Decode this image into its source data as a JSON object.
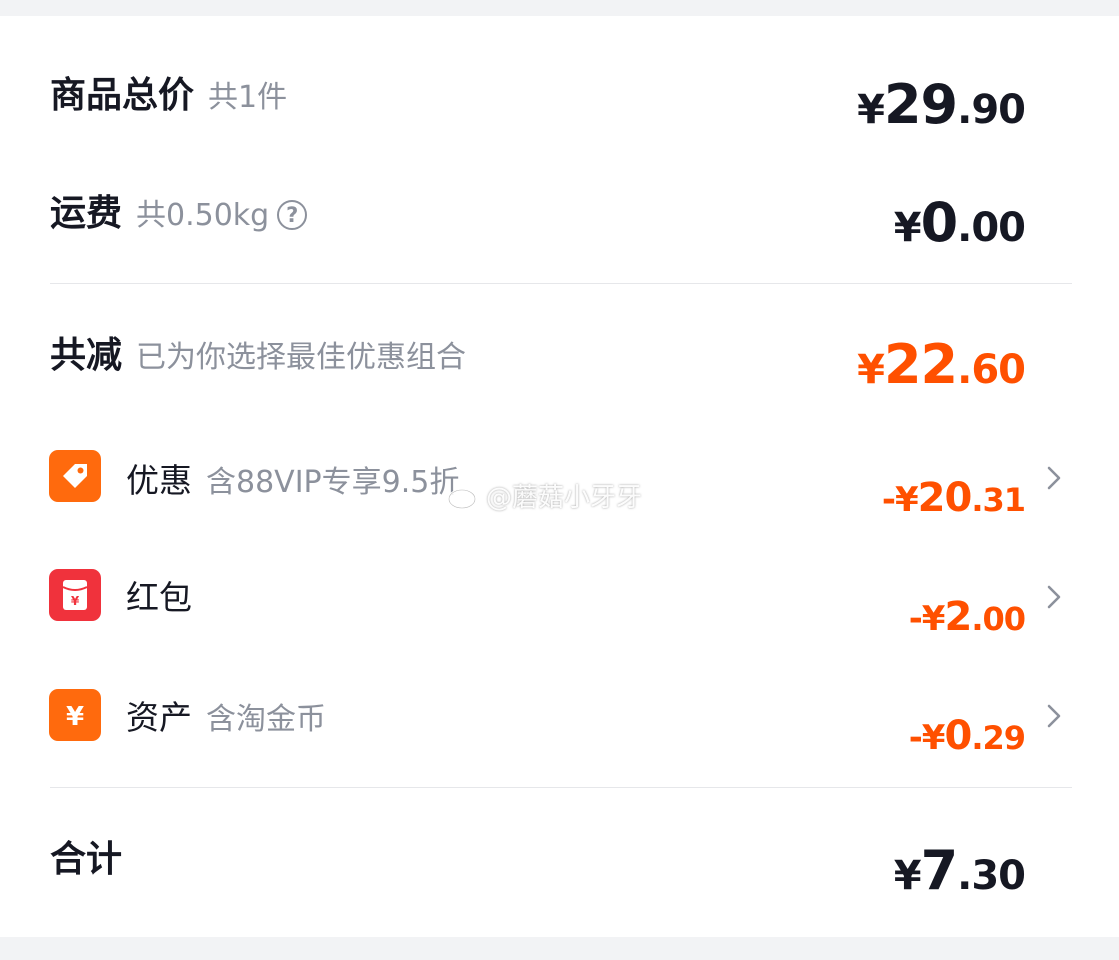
{
  "summary": {
    "goods_total": {
      "label": "商品总价",
      "note": "共1件",
      "currency": "¥",
      "int": "29",
      "dec": ".90"
    },
    "shipping": {
      "label": "运费",
      "note": "共0.50kg",
      "currency": "¥",
      "int": "0",
      "dec": ".00"
    },
    "reduction": {
      "label": "共减",
      "note": "已为你选择最佳优惠组合",
      "currency": "¥",
      "int": "22",
      "dec": ".60"
    },
    "items": [
      {
        "label": "优惠",
        "note": "含88VIP专享9.5折",
        "currency": "-¥",
        "int": "20",
        "dec": ".31",
        "icon": "tag-icon"
      },
      {
        "label": "红包",
        "note": "",
        "currency": "-¥",
        "int": "2",
        "dec": ".00",
        "icon": "red-envelope-icon"
      },
      {
        "label": "资产",
        "note": "含淘金币",
        "currency": "-¥",
        "int": "0",
        "dec": ".29",
        "icon": "yen-coin-icon"
      }
    ],
    "total": {
      "label": "合计",
      "currency": "¥",
      "int": "7",
      "dec": ".30"
    }
  },
  "watermark": {
    "text": "@蘑菇小牙牙"
  },
  "colors": {
    "accent": "#ff5000",
    "text": "#161823",
    "muted": "#8c919c",
    "red": "#f0323c"
  }
}
